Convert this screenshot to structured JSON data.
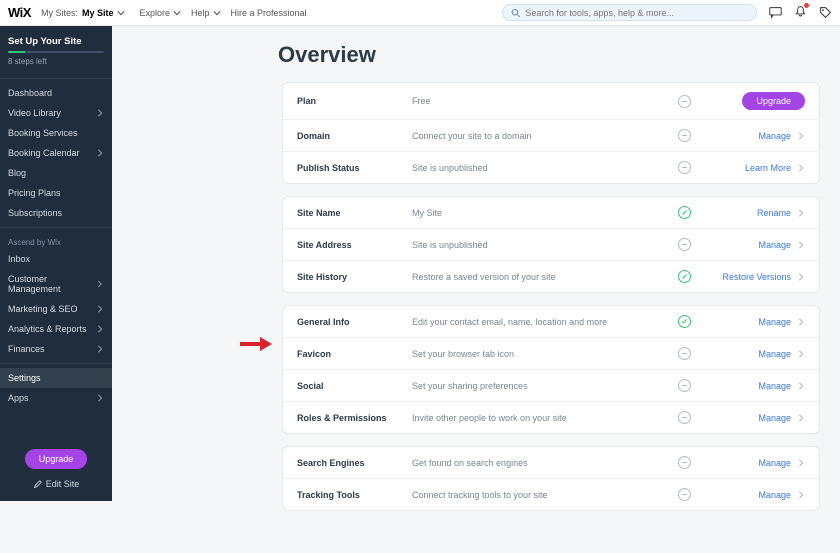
{
  "topbar": {
    "logo": "WiX",
    "sitepicker_prefix": "My Sites:",
    "sitepicker_name": "My Site",
    "explore": "Explore",
    "help": "Help",
    "hire": "Hire a Professional",
    "search_placeholder": "Search for tools, apps, help & more..."
  },
  "sidebar": {
    "setup": {
      "title": "Set Up Your Site",
      "steps": "8 steps left"
    },
    "items1": [
      {
        "label": "Dashboard"
      },
      {
        "label": "Video Library",
        "chev": true
      },
      {
        "label": "Booking Services"
      },
      {
        "label": "Booking Calendar",
        "chev": true
      },
      {
        "label": "Blog"
      },
      {
        "label": "Pricing Plans"
      },
      {
        "label": "Subscriptions"
      }
    ],
    "ascend": "Ascend by Wix",
    "items2": [
      {
        "label": "Inbox"
      },
      {
        "label": "Customer Management",
        "chev": true
      },
      {
        "label": "Marketing & SEO",
        "chev": true
      },
      {
        "label": "Analytics & Reports",
        "chev": true
      },
      {
        "label": "Finances",
        "chev": true
      }
    ],
    "items3": [
      {
        "label": "Settings",
        "active": true
      },
      {
        "label": "Apps",
        "chev": true
      }
    ],
    "upgrade": "Upgrade",
    "edit": "Edit Site"
  },
  "page": {
    "title": "Overview"
  },
  "groups": [
    [
      {
        "label": "Plan",
        "value": "Free",
        "status": "dash",
        "action": "Upgrade",
        "action_type": "pill"
      },
      {
        "label": "Domain",
        "value": "Connect your site to a domain",
        "status": "dash",
        "action": "Manage",
        "action_type": "link"
      },
      {
        "label": "Publish Status",
        "value": "Site is unpublished",
        "status": "dash",
        "action": "Learn More",
        "action_type": "link"
      }
    ],
    [
      {
        "label": "Site Name",
        "value": "My Site",
        "status": "check",
        "action": "Rename",
        "action_type": "link"
      },
      {
        "label": "Site Address",
        "value": "Site is unpublished",
        "status": "dash",
        "action": "Manage",
        "action_type": "link"
      },
      {
        "label": "Site History",
        "value": "Restore a saved version of your site",
        "status": "check",
        "action": "Restore Versions",
        "action_type": "link"
      }
    ],
    [
      {
        "label": "General Info",
        "value": "Edit your contact email, name, location and more",
        "status": "check",
        "action": "Manage",
        "action_type": "link"
      },
      {
        "label": "Favicon",
        "value": "Set your browser tab icon",
        "status": "dash",
        "action": "Manage",
        "action_type": "link"
      },
      {
        "label": "Social",
        "value": "Set your sharing preferences",
        "status": "dash",
        "action": "Manage",
        "action_type": "link"
      },
      {
        "label": "Roles & Permissions",
        "value": "Invite other people to work on your site",
        "status": "dash",
        "action": "Manage",
        "action_type": "link"
      }
    ],
    [
      {
        "label": "Search Engines",
        "value": "Get found on search engines",
        "status": "dash",
        "action": "Manage",
        "action_type": "link"
      },
      {
        "label": "Tracking Tools",
        "value": "Connect tracking tools to your site",
        "status": "dash",
        "action": "Manage",
        "action_type": "link"
      }
    ]
  ]
}
